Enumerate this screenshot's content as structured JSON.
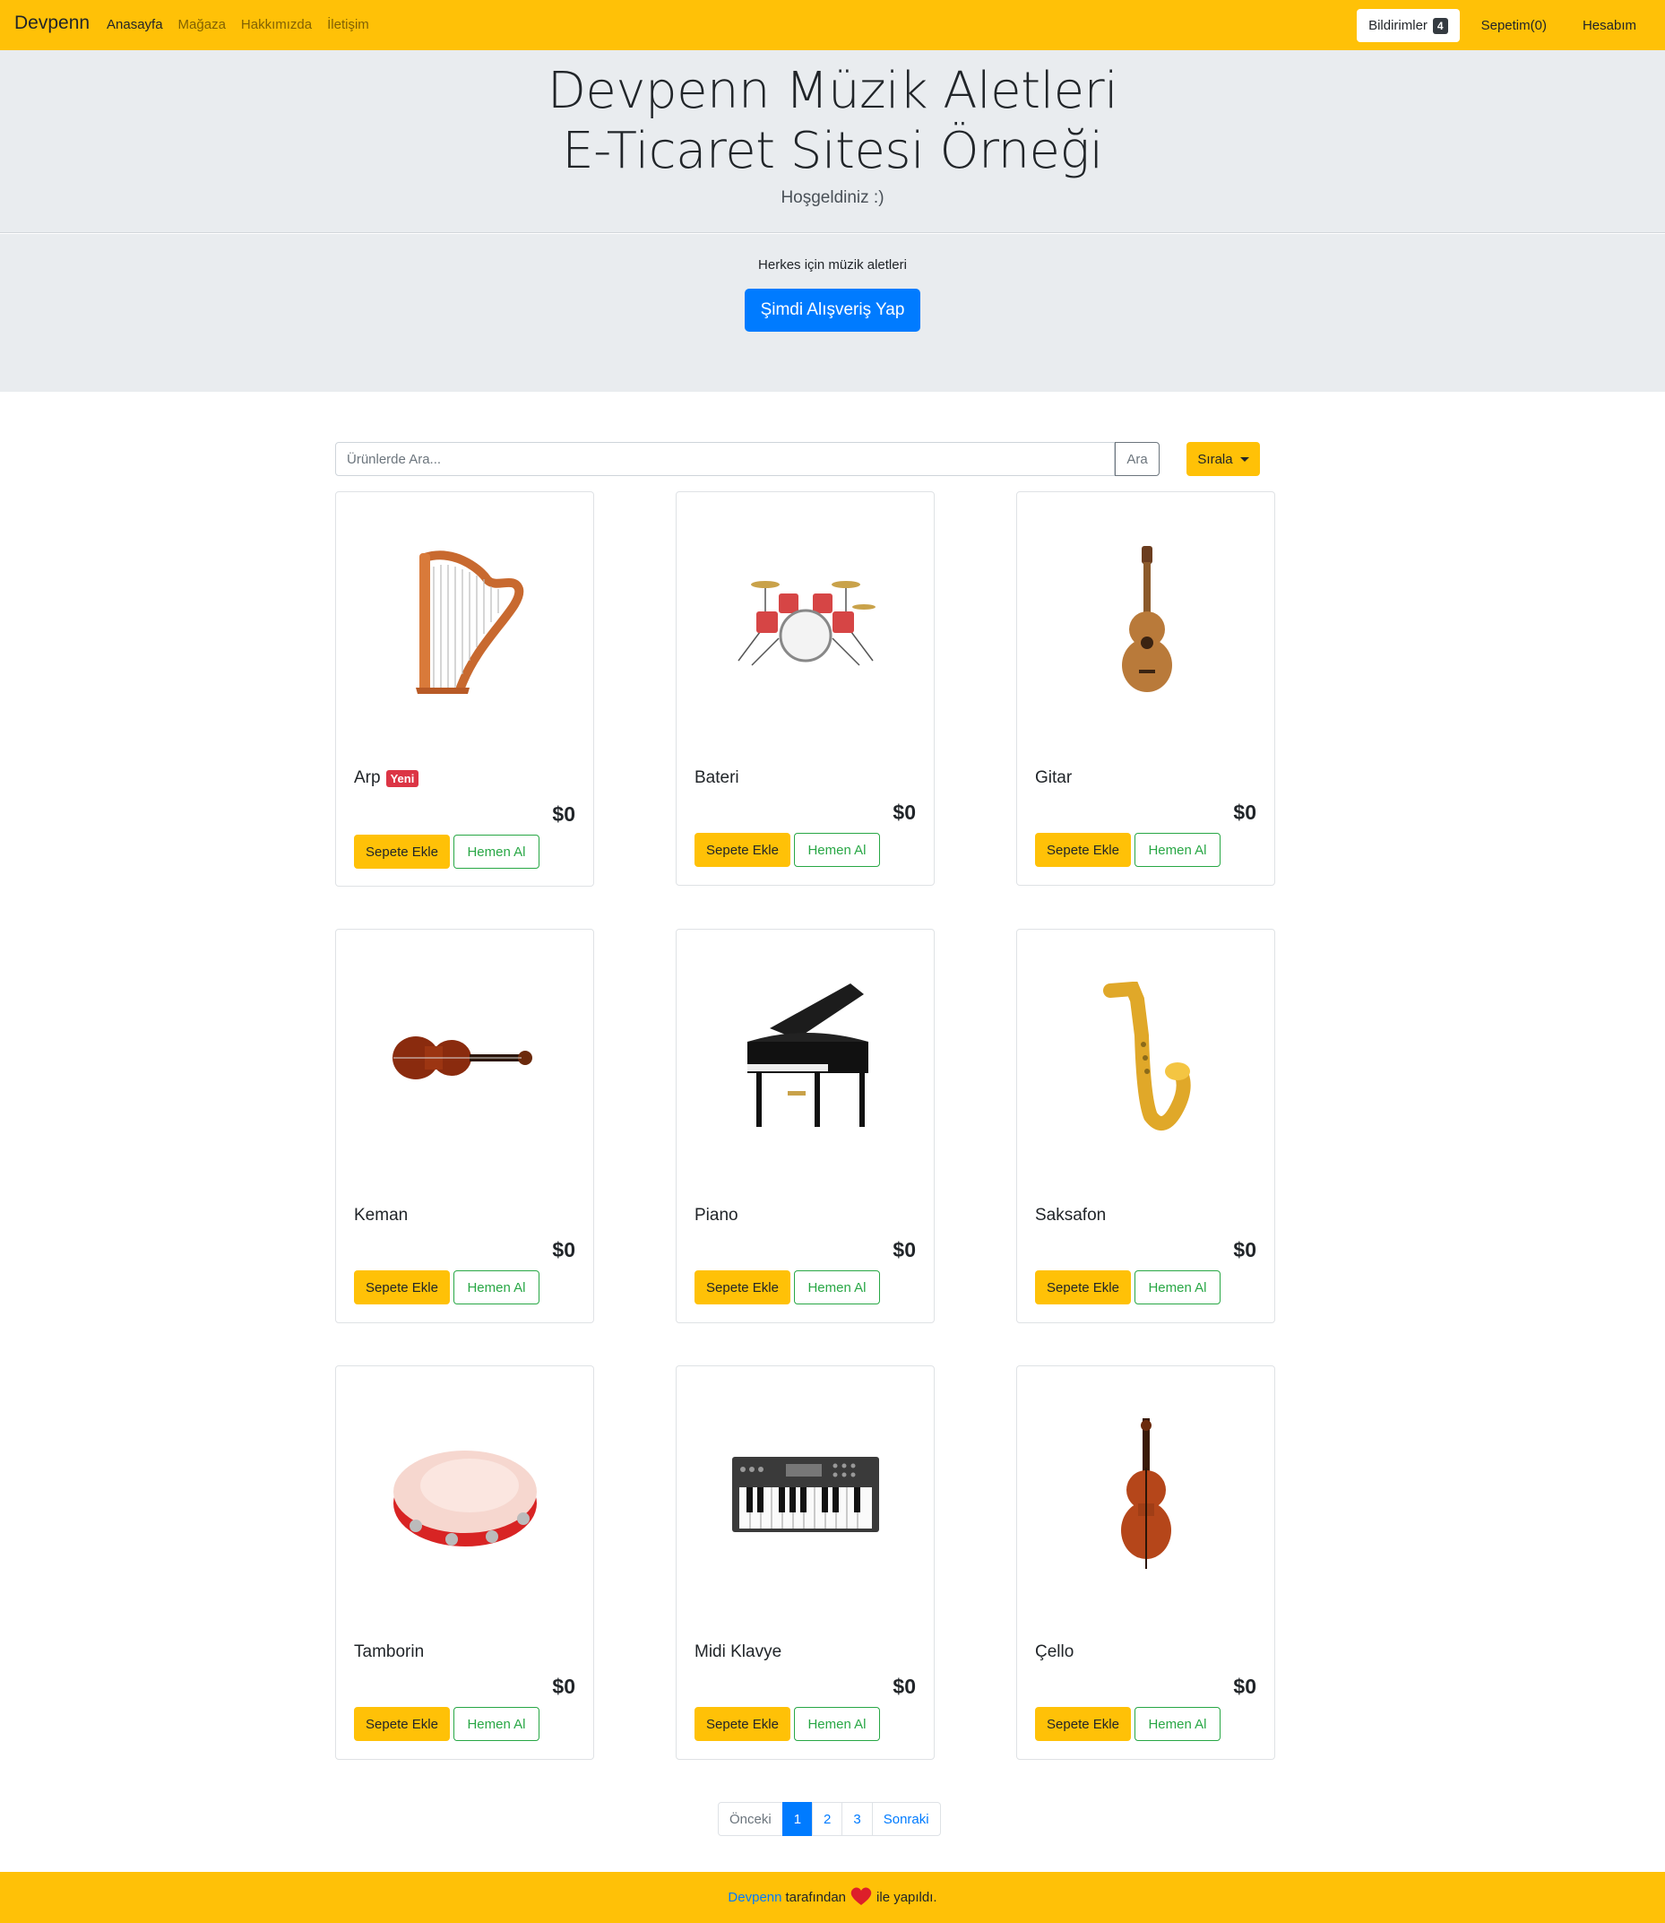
{
  "navbar": {
    "brand": "Devpenn",
    "links": [
      {
        "label": "Anasayfa",
        "active": true
      },
      {
        "label": "Mağaza",
        "active": false
      },
      {
        "label": "Hakkımızda",
        "active": false
      },
      {
        "label": "İletişim",
        "active": false
      }
    ],
    "notifications": {
      "label": "Bildirimler",
      "count": "4"
    },
    "cart": "Sepetim(0)",
    "account": "Hesabım"
  },
  "hero": {
    "title_line1": "Devpenn Müzik Aletleri",
    "title_line2": "E-Ticaret Sitesi Örneği",
    "welcome": "Hoşgeldiniz :)",
    "tagline": "Herkes için müzik aletleri",
    "cta": "Şimdi Alışveriş Yap"
  },
  "search": {
    "placeholder": "Ürünlerde Ara...",
    "button": "Ara"
  },
  "sort": {
    "label": "Sırala"
  },
  "products": [
    {
      "name": "Arp",
      "badge": "Yeni",
      "price": "$0",
      "icon": "harp-icon"
    },
    {
      "name": "Bateri",
      "badge": "",
      "price": "$0",
      "icon": "drum-kit-icon"
    },
    {
      "name": "Gitar",
      "badge": "",
      "price": "$0",
      "icon": "guitar-icon"
    },
    {
      "name": "Keman",
      "badge": "",
      "price": "$0",
      "icon": "violin-icon"
    },
    {
      "name": "Piano",
      "badge": "",
      "price": "$0",
      "icon": "piano-icon"
    },
    {
      "name": "Saksafon",
      "badge": "",
      "price": "$0",
      "icon": "saxophone-icon"
    },
    {
      "name": "Tamborin",
      "badge": "",
      "price": "$0",
      "icon": "tambourine-icon"
    },
    {
      "name": "Midi Klavye",
      "badge": "",
      "price": "$0",
      "icon": "midi-keyboard-icon"
    },
    {
      "name": "Çello",
      "badge": "",
      "price": "$0",
      "icon": "cello-icon"
    }
  ],
  "buttons": {
    "add_to_cart": "Sepete Ekle",
    "buy_now": "Hemen Al"
  },
  "pagination": {
    "prev": "Önceki",
    "pages": [
      "1",
      "2",
      "3"
    ],
    "current": "1",
    "next": "Sonraki"
  },
  "footer": {
    "brand": "Devpenn",
    "text_before": "tarafından",
    "text_after": "ile yapıldı."
  },
  "colors": {
    "accent": "#ffc107",
    "primary": "#007bff",
    "success": "#28a745",
    "danger": "#dc3545",
    "jumbotron": "#e9ecef"
  }
}
